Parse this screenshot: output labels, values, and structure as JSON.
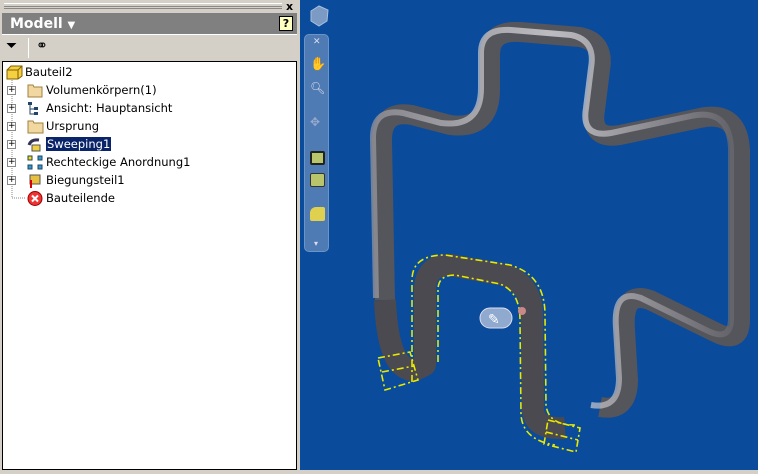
{
  "panel": {
    "title": "Modell",
    "help_label": "?",
    "close_label": "x"
  },
  "tree": {
    "root": "Bauteil2",
    "items": [
      {
        "label": "Volumenkörpern(1)",
        "icon": "solid-bodies-icon"
      },
      {
        "label": "Ansicht: Hauptansicht",
        "icon": "view-rep-icon"
      },
      {
        "label": "Ursprung",
        "icon": "folder-icon"
      },
      {
        "label": "Sweeping1",
        "icon": "sweep-icon",
        "selected": true
      },
      {
        "label": "Rechteckige Anordnung1",
        "icon": "rect-pattern-icon"
      },
      {
        "label": "Biegungsteil1",
        "icon": "bend-part-icon"
      },
      {
        "label": "Bauteilende",
        "icon": "end-of-part-icon"
      }
    ]
  },
  "colors": {
    "viewport": "#0a4b9b",
    "selection": "#0a246a",
    "highlight": "#e8e800"
  }
}
